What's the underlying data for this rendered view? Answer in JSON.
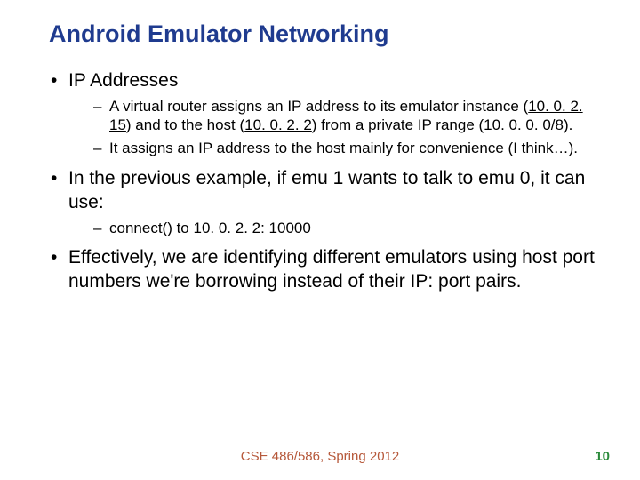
{
  "title": "Android Emulator Networking",
  "bullets": {
    "b1": "IP Addresses",
    "b1s1a": "A virtual router assigns an IP address to its emulator instance (",
    "b1s1ip1": "10. 0. 2. 15",
    "b1s1b": ") and to the host (",
    "b1s1ip2": "10. 0. 2. 2",
    "b1s1c": ") from a private IP range (10. 0. 0. 0/8).",
    "b1s2": "It assigns an IP address to the host mainly for convenience (I think…).",
    "b2": "In the previous example, if emu 1 wants to talk to emu 0, it can use:",
    "b2s1": "connect() to 10. 0. 2. 2: 10000",
    "b3": "Effectively, we are identifying different emulators using host port numbers we're borrowing instead of their IP: port pairs."
  },
  "footer": "CSE 486/586, Spring 2012",
  "page": "10"
}
